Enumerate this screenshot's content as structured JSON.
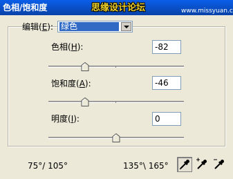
{
  "window": {
    "title": "色相/饱和度"
  },
  "watermark": {
    "text": "思缘设计论坛",
    "site": "www.missyuan.com"
  },
  "edit": {
    "label_prefix": "编辑(",
    "label_key": "E",
    "label_suffix": "):",
    "selected": "绿色"
  },
  "hue": {
    "label_prefix": "色相(",
    "label_key": "H",
    "label_suffix": "):",
    "value": "-82",
    "slider_fraction": 0.27
  },
  "saturation": {
    "label_prefix": "饱和度(",
    "label_key": "A",
    "label_suffix": "):",
    "value": "-46",
    "slider_fraction": 0.27
  },
  "lightness": {
    "label_prefix": "明度(",
    "label_key": "I",
    "label_suffix": "):",
    "value": "0",
    "slider_fraction": 0.5
  },
  "range": {
    "left": "75°/ 105°",
    "right": "135°\\ 165°"
  },
  "tools": {
    "eyedropper_icon": "eyedropper-icon",
    "eyedropper_add_icon": "eyedropper-plus-icon",
    "eyedropper_subtract_icon": "eyedropper-minus-icon"
  }
}
